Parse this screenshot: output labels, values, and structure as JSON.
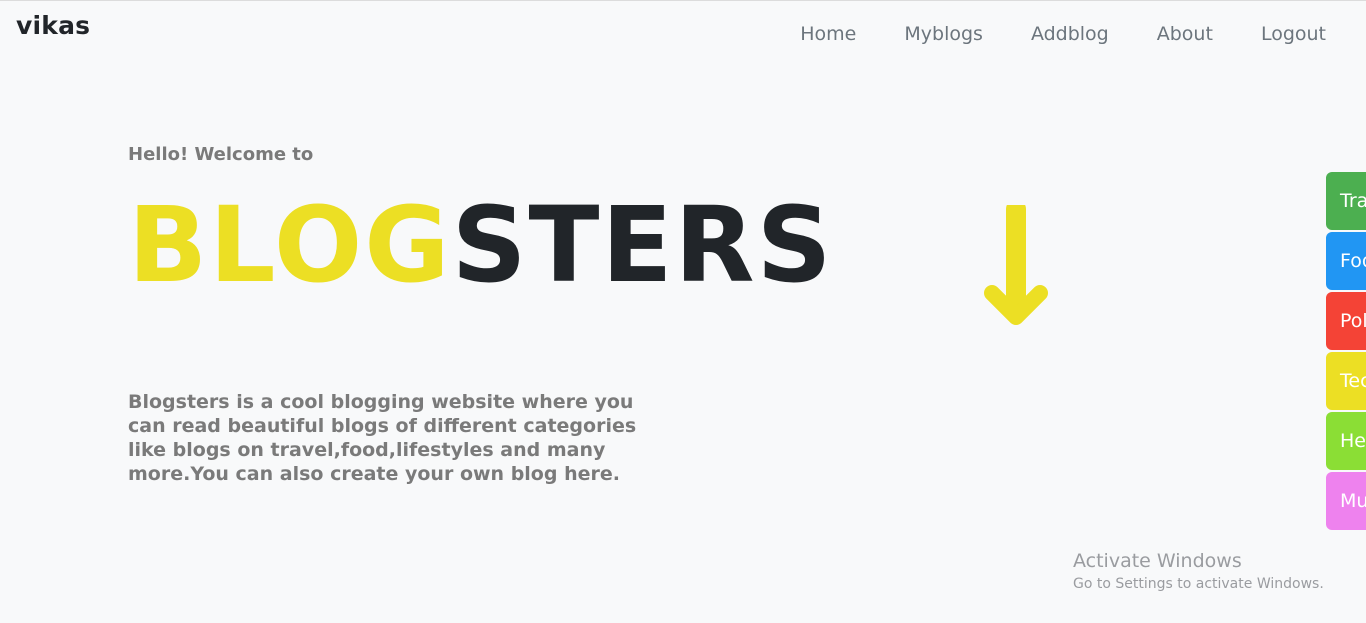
{
  "header": {
    "brand": "vikas",
    "nav": [
      "Home",
      "Myblogs",
      "Addblog",
      "About",
      "Logout"
    ]
  },
  "main": {
    "greeting": "Hello! Welcome to",
    "title_part1": "BLOG",
    "title_part2": "STERS",
    "description": "Blogsters is a cool blogging website where you can read beautiful blogs of different categories like blogs on travel,food,lifestyles and many more.You can also create your own blog here."
  },
  "categories": [
    {
      "label": "Tra",
      "color": "#4caf50"
    },
    {
      "label": "Foo",
      "color": "#2196f3"
    },
    {
      "label": "Pol",
      "color": "#f44336"
    },
    {
      "label": "Tec",
      "color": "#ecdf24"
    },
    {
      "label": "He",
      "color": "#8bde35"
    },
    {
      "label": "Mu",
      "color": "#ee82ee"
    }
  ],
  "colors": {
    "accent_yellow": "#ecdf24",
    "dark": "#212529"
  },
  "icons": {
    "scroll": "arrow-down-icon"
  },
  "watermark": {
    "line1": "Activate Windows",
    "line2": "Go to Settings to activate Windows."
  }
}
